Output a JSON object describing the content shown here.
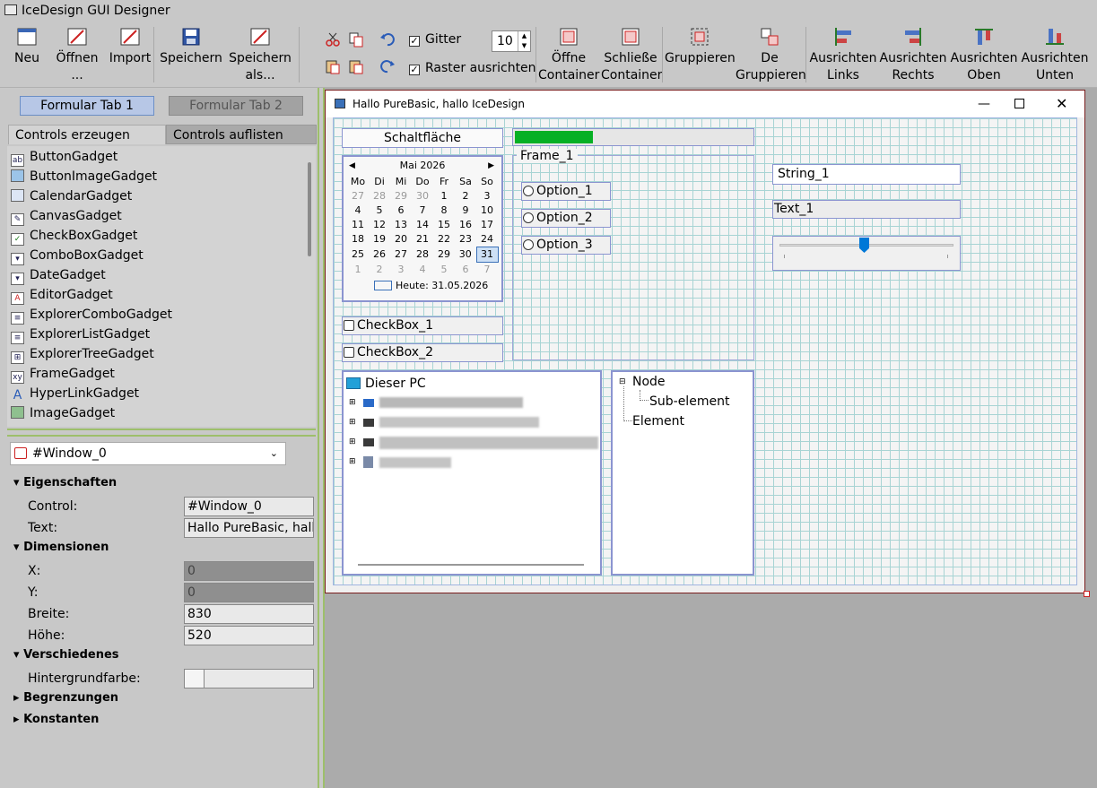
{
  "app": {
    "title": "IceDesign GUI Designer"
  },
  "toolbar": {
    "new": "Neu",
    "open": "Öffnen ...",
    "import": "Import",
    "save": "Speichern",
    "save_as_1": "Speichern",
    "save_as_2": "als...",
    "grid_label": "Gitter",
    "snap_label": "Raster ausrichten",
    "grid_size": "10",
    "open_container_1": "Öffne",
    "open_container_2": "Container",
    "close_container_1": "Schließe",
    "close_container_2": "Container",
    "group": "Gruppieren",
    "ungroup_1": "De",
    "ungroup_2": "Gruppieren",
    "align_left_1": "Ausrichten",
    "align_left_2": "Links",
    "align_right_1": "Ausrichten",
    "align_right_2": "Rechts",
    "align_top_1": "Ausrichten",
    "align_top_2": "Oben",
    "align_bottom_1": "Ausrichten",
    "align_bottom_2": "Unten"
  },
  "left": {
    "form_tab1": "Formular Tab 1",
    "form_tab2": "Formular Tab 2",
    "tab_create": "Controls erzeugen",
    "tab_list": "Controls auflisten",
    "controls": [
      "ButtonGadget",
      "ButtonImageGadget",
      "CalendarGadget",
      "CanvasGadget",
      "CheckBoxGadget",
      "ComboBoxGadget",
      "DateGadget",
      "EditorGadget",
      "ExplorerComboGadget",
      "ExplorerListGadget",
      "ExplorerTreeGadget",
      "FrameGadget",
      "HyperLinkGadget",
      "ImageGadget"
    ],
    "window_select": "#Window_0",
    "props": {
      "sec_props": "Eigenschaften",
      "control_label": "Control:",
      "control_val": "#Window_0",
      "text_label": "Text:",
      "text_val": "Hallo PureBasic, hallo IceDesign",
      "sec_dims": "Dimensionen",
      "x_label": "X:",
      "x_val": "0",
      "y_label": "Y:",
      "y_val": "0",
      "w_label": "Breite:",
      "w_val": "830",
      "h_label": "Höhe:",
      "h_val": "520",
      "sec_misc": "Verschiedenes",
      "bg_label": "Hintergrundfarbe:",
      "sec_limits": "Begrenzungen",
      "sec_consts": "Konstanten"
    }
  },
  "design": {
    "title": "Hallo PureBasic, hallo IceDesign",
    "button": "Schaltfläche",
    "progress": 0.33,
    "frame": "Frame_1",
    "options": [
      "Option_1",
      "Option_2",
      "Option_3"
    ],
    "string": "String_1",
    "text": "Text_1",
    "slider": 0.5,
    "checkboxes": [
      "CheckBox_1",
      "CheckBox_2"
    ],
    "calendar": {
      "month": "Mai 2026",
      "days": [
        "Mo",
        "Di",
        "Mi",
        "Do",
        "Fr",
        "Sa",
        "So"
      ],
      "rows": [
        [
          "27",
          "28",
          "29",
          "30",
          "1",
          "2",
          "3"
        ],
        [
          "4",
          "5",
          "6",
          "7",
          "8",
          "9",
          "10"
        ],
        [
          "11",
          "12",
          "13",
          "14",
          "15",
          "16",
          "17"
        ],
        [
          "18",
          "19",
          "20",
          "21",
          "22",
          "23",
          "24"
        ],
        [
          "25",
          "26",
          "27",
          "28",
          "29",
          "30",
          "31"
        ],
        [
          "1",
          "2",
          "3",
          "4",
          "5",
          "6",
          "7"
        ]
      ],
      "today": "Heute: 31.05.2026"
    },
    "explorer": {
      "root": "Dieser PC"
    },
    "tree": {
      "node": "Node",
      "sub": "Sub-element",
      "element": "Element"
    }
  },
  "colors": {
    "accent": "#b7c7e6",
    "progress": "#06b025",
    "slider": "#0078d7"
  }
}
